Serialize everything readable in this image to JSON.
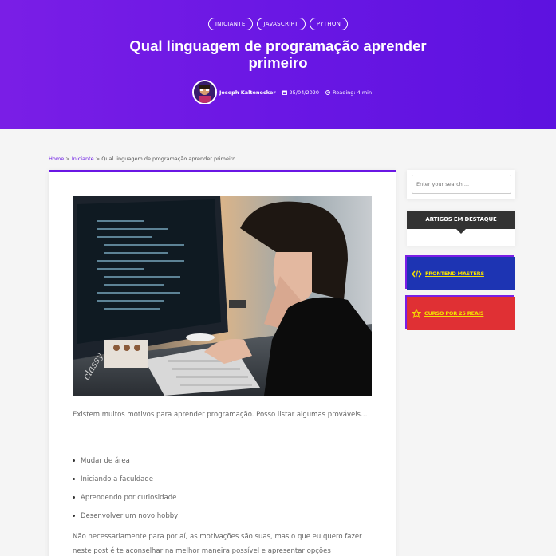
{
  "hero": {
    "tags": [
      "INICIANTE",
      "JAVASCRIPT",
      "PYTHON"
    ],
    "title": "Qual linguagem de programação aprender primeiro",
    "author": "Joseph Kaltenecker",
    "date": "25/04/2020",
    "reading": "Reading: 4 min"
  },
  "breadcrumb": {
    "home": "Home",
    "category": "Iniciante",
    "sep": ">",
    "current": "Qual linguagem de programação aprender primeiro"
  },
  "article": {
    "p1": "Existem muitos motivos para aprender programação. Posso listar algumas prováveis…",
    "list": [
      "Mudar de área",
      "Iniciando a faculdade",
      "Aprendendo por curiosidade",
      "Desenvolver um novo hobby"
    ],
    "p2": "Não necessariamente para por aí, as motivações são suas, mas o que eu quero fazer neste post é te aconselhar na melhor maneira possível e apresentar opções"
  },
  "sidebar": {
    "search_placeholder": "Enter your search ...",
    "featured_title": "ARTIGOS EM DESTAQUE",
    "promo1": "FRONTEND MASTERS",
    "promo2": "CURSO POR 25 REAIS"
  },
  "colors": {
    "accent": "#6a17e4",
    "promo1_bg": "#1d34b3",
    "promo2_bg": "#e03034",
    "promo_text": "#f5e100"
  },
  "icons": [
    "calendar-icon",
    "clock-icon",
    "code-icon",
    "star-icon"
  ]
}
